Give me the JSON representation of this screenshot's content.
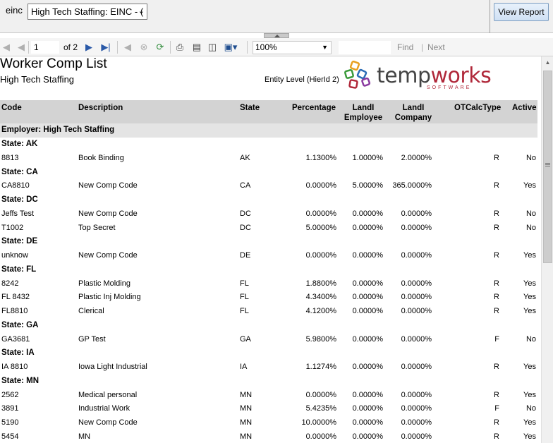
{
  "params": {
    "label": "einc",
    "selected": "High Tech Staffing: EINC - (",
    "view_report": "View Report"
  },
  "toolbar": {
    "page_value": "1",
    "page_of": "of",
    "page_total": "2",
    "zoom": "100%",
    "find": "Find",
    "separator": "|",
    "next": "Next"
  },
  "report": {
    "title": "Worker Comp List",
    "subtitle": "High Tech Staffing",
    "entity_level": "Entity Level (HierId 2)",
    "logo_text_a": "temp",
    "logo_text_b": "works",
    "logo_sub": "SOFTWARE",
    "headers": {
      "code": "Code",
      "description": "Description",
      "state": "State",
      "percentage": "Percentage",
      "landi_emp_1": "LandI",
      "landi_emp_2": "Employee",
      "landi_comp_1": "LandI",
      "landi_comp_2": "Company",
      "otcalc": "OTCalcType",
      "active": "Active"
    },
    "employer": "Employer: High Tech Staffing",
    "rows": [
      {
        "kind": "state",
        "label": "State: AK"
      },
      {
        "kind": "data",
        "code": "8813",
        "desc": "Book Binding",
        "state": "AK",
        "pct": "1.1300%",
        "emp": "1.0000%",
        "comp": "2.0000%",
        "ot": "R",
        "active": "No"
      },
      {
        "kind": "state",
        "label": "State: CA"
      },
      {
        "kind": "data",
        "code": "CA8810",
        "desc": "New Comp Code",
        "state": "CA",
        "pct": "0.0000%",
        "emp": "5.0000%",
        "comp": "365.0000%",
        "ot": "R",
        "active": "Yes"
      },
      {
        "kind": "state",
        "label": "State: DC"
      },
      {
        "kind": "data",
        "code": "Jeffs Test",
        "desc": "New Comp Code",
        "state": "DC",
        "pct": "0.0000%",
        "emp": "0.0000%",
        "comp": "0.0000%",
        "ot": "R",
        "active": "No"
      },
      {
        "kind": "data",
        "code": "T1002",
        "desc": "Top Secret",
        "state": "DC",
        "pct": "5.0000%",
        "emp": "0.0000%",
        "comp": "0.0000%",
        "ot": "R",
        "active": "No"
      },
      {
        "kind": "state",
        "label": "State: DE"
      },
      {
        "kind": "data",
        "code": "unknow",
        "desc": "New Comp Code",
        "state": "DE",
        "pct": "0.0000%",
        "emp": "0.0000%",
        "comp": "0.0000%",
        "ot": "R",
        "active": "Yes"
      },
      {
        "kind": "state",
        "label": "State: FL"
      },
      {
        "kind": "data",
        "code": "8242",
        "desc": "Plastic Molding",
        "state": "FL",
        "pct": "1.8800%",
        "emp": "0.0000%",
        "comp": "0.0000%",
        "ot": "R",
        "active": "Yes"
      },
      {
        "kind": "data",
        "code": "FL 8432",
        "desc": "Plastic Inj Molding",
        "state": "FL",
        "pct": "4.3400%",
        "emp": "0.0000%",
        "comp": "0.0000%",
        "ot": "R",
        "active": "Yes"
      },
      {
        "kind": "data",
        "code": "FL8810",
        "desc": "Clerical",
        "state": "FL",
        "pct": "4.1200%",
        "emp": "0.0000%",
        "comp": "0.0000%",
        "ot": "R",
        "active": "Yes"
      },
      {
        "kind": "state",
        "label": "State: GA"
      },
      {
        "kind": "data",
        "code": "GA3681",
        "desc": "GP Test",
        "state": "GA",
        "pct": "5.9800%",
        "emp": "0.0000%",
        "comp": "0.0000%",
        "ot": "F",
        "active": "No"
      },
      {
        "kind": "state",
        "label": "State: IA"
      },
      {
        "kind": "data",
        "code": "IA 8810",
        "desc": "Iowa Light Industrial",
        "state": "IA",
        "pct": "1.1274%",
        "emp": "0.0000%",
        "comp": "0.0000%",
        "ot": "R",
        "active": "Yes"
      },
      {
        "kind": "state",
        "label": "State: MN"
      },
      {
        "kind": "data",
        "code": "2562",
        "desc": "Medical personal",
        "state": "MN",
        "pct": "0.0000%",
        "emp": "0.0000%",
        "comp": "0.0000%",
        "ot": "R",
        "active": "Yes"
      },
      {
        "kind": "data",
        "code": "3891",
        "desc": "Industrial Work",
        "state": "MN",
        "pct": "5.4235%",
        "emp": "0.0000%",
        "comp": "0.0000%",
        "ot": "F",
        "active": "No"
      },
      {
        "kind": "data",
        "code": "5190",
        "desc": "New Comp Code",
        "state": "MN",
        "pct": "10.0000%",
        "emp": "0.0000%",
        "comp": "0.0000%",
        "ot": "R",
        "active": "Yes"
      },
      {
        "kind": "data",
        "code": "5454",
        "desc": "MN",
        "state": "MN",
        "pct": "0.0000%",
        "emp": "0.0000%",
        "comp": "0.0000%",
        "ot": "R",
        "active": "Yes"
      }
    ]
  },
  "colors": {
    "header_bg": "#d3d3d3",
    "employer_bg": "#e4e4e4",
    "logo_red": "#b0283a",
    "toolbar_blue": "#2b5aa8"
  },
  "icons": [
    "first-page-icon",
    "prev-page-icon",
    "next-page-icon",
    "last-page-icon",
    "back-icon",
    "stop-icon",
    "refresh-icon",
    "print-icon",
    "print-layout-icon",
    "page-setup-icon",
    "export-icon",
    "chevron-down-icon"
  ]
}
